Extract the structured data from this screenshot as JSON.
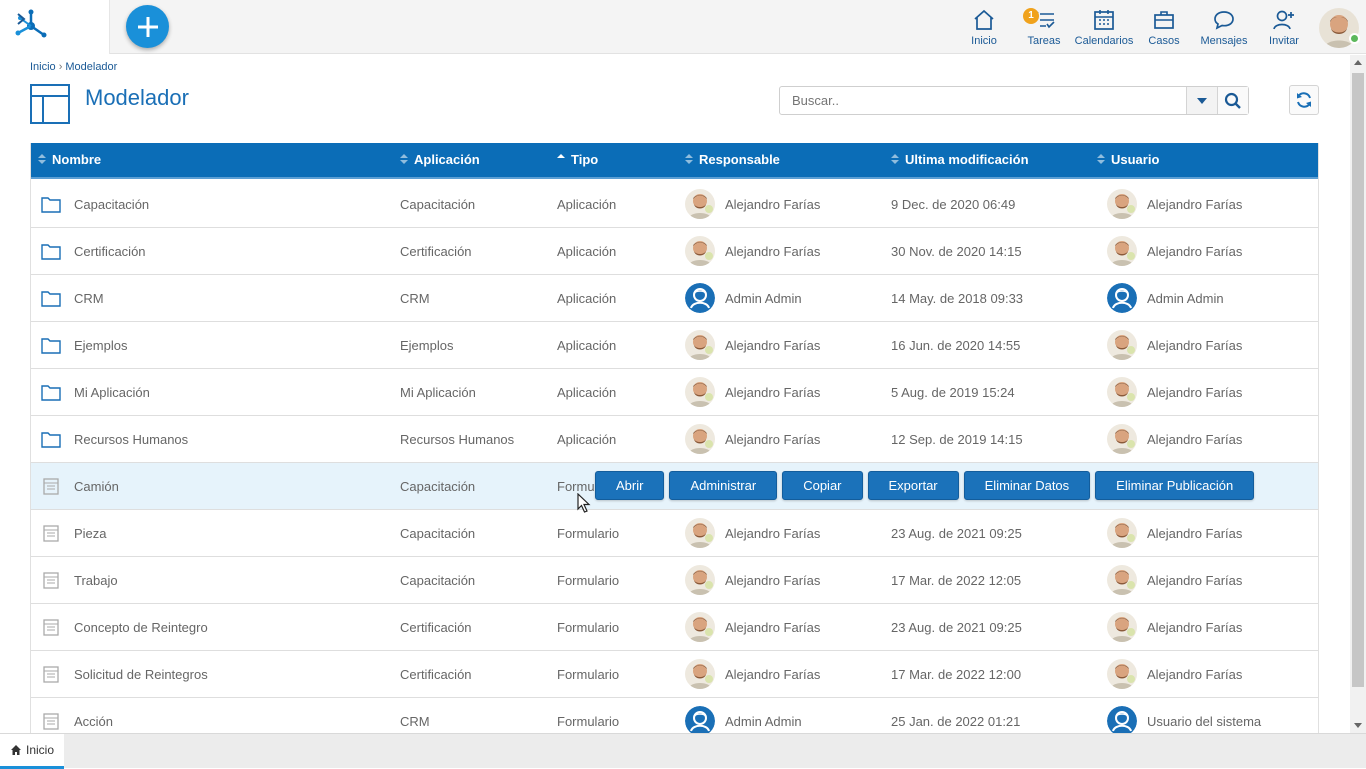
{
  "topbar": {
    "nav": [
      {
        "label": "Inicio",
        "icon": "home-icon"
      },
      {
        "label": "Tareas",
        "icon": "tasks-icon",
        "badge": "1"
      },
      {
        "label": "Calendarios",
        "icon": "calendar-icon"
      },
      {
        "label": "Casos",
        "icon": "briefcase-icon"
      },
      {
        "label": "Mensajes",
        "icon": "message-icon"
      },
      {
        "label": "Invitar",
        "icon": "invite-user-icon"
      }
    ]
  },
  "breadcrumb": {
    "home": "Inicio",
    "sep": "›",
    "current": "Modelador"
  },
  "page": {
    "title": "Modelador"
  },
  "search": {
    "placeholder": "Buscar.."
  },
  "grid": {
    "headers": {
      "nombre": "Nombre",
      "aplicacion": "Aplicación",
      "tipo": "Tipo",
      "responsable": "Responsable",
      "modificacion": "Ultima modificación",
      "usuario": "Usuario"
    },
    "rows": [
      {
        "nombre": "Capacitación",
        "aplicacion": "Capacitación",
        "tipo": "Aplicación",
        "responsable": "Alejandro Farías",
        "modificacion": "9 Dec. de 2020 06:49",
        "usuario": "Alejandro Farías"
      },
      {
        "nombre": "Certificación",
        "aplicacion": "Certificación",
        "tipo": "Aplicación",
        "responsable": "Alejandro Farías",
        "modificacion": "30 Nov. de 2020 14:15",
        "usuario": "Alejandro Farías"
      },
      {
        "nombre": "CRM",
        "aplicacion": "CRM",
        "tipo": "Aplicación",
        "responsable": "Admin Admin",
        "modificacion": "14 May. de 2018 09:33",
        "usuario": "Admin Admin"
      },
      {
        "nombre": "Ejemplos",
        "aplicacion": "Ejemplos",
        "tipo": "Aplicación",
        "responsable": "Alejandro Farías",
        "modificacion": "16 Jun. de 2020 14:55",
        "usuario": "Alejandro Farías"
      },
      {
        "nombre": "Mi Aplicación",
        "aplicacion": "Mi Aplicación",
        "tipo": "Aplicación",
        "responsable": "Alejandro Farías",
        "modificacion": "5 Aug. de 2019 15:24",
        "usuario": "Alejandro Farías"
      },
      {
        "nombre": "Recursos Humanos",
        "aplicacion": "Recursos Humanos",
        "tipo": "Aplicación",
        "responsable": "Alejandro Farías",
        "modificacion": "12 Sep. de 2019 14:15",
        "usuario": "Alejandro Farías"
      },
      {
        "nombre": "Camión",
        "aplicacion": "Capacitación",
        "tipo": "Formulario",
        "responsable": "",
        "modificacion": "",
        "usuario": ""
      },
      {
        "nombre": "Pieza",
        "aplicacion": "Capacitación",
        "tipo": "Formulario",
        "responsable": "Alejandro Farías",
        "modificacion": "23 Aug. de 2021 09:25",
        "usuario": "Alejandro Farías"
      },
      {
        "nombre": "Trabajo",
        "aplicacion": "Capacitación",
        "tipo": "Formulario",
        "responsable": "Alejandro Farías",
        "modificacion": "17 Mar. de 2022 12:05",
        "usuario": "Alejandro Farías"
      },
      {
        "nombre": "Concepto de Reintegro",
        "aplicacion": "Certificación",
        "tipo": "Formulario",
        "responsable": "Alejandro Farías",
        "modificacion": "23 Aug. de 2021 09:25",
        "usuario": "Alejandro Farías"
      },
      {
        "nombre": "Solicitud de Reintegros",
        "aplicacion": "Certificación",
        "tipo": "Formulario",
        "responsable": "Alejandro Farías",
        "modificacion": "17 Mar. de 2022 12:00",
        "usuario": "Alejandro Farías"
      },
      {
        "nombre": "Acción",
        "aplicacion": "CRM",
        "tipo": "Formulario",
        "responsable": "Admin Admin",
        "modificacion": "25 Jan. de 2022 01:21",
        "usuario": "Usuario del sistema"
      }
    ],
    "row_actions": [
      "Abrir",
      "Administrar",
      "Copiar",
      "Exportar",
      "Eliminar Datos",
      "Eliminar Publicación"
    ]
  },
  "footer": {
    "tab": "Inicio"
  },
  "colors": {
    "accent": "#0b6db7",
    "add_button": "#1a90d9",
    "badge": "#f0a21c",
    "row_highlight": "#e6f3fb"
  }
}
